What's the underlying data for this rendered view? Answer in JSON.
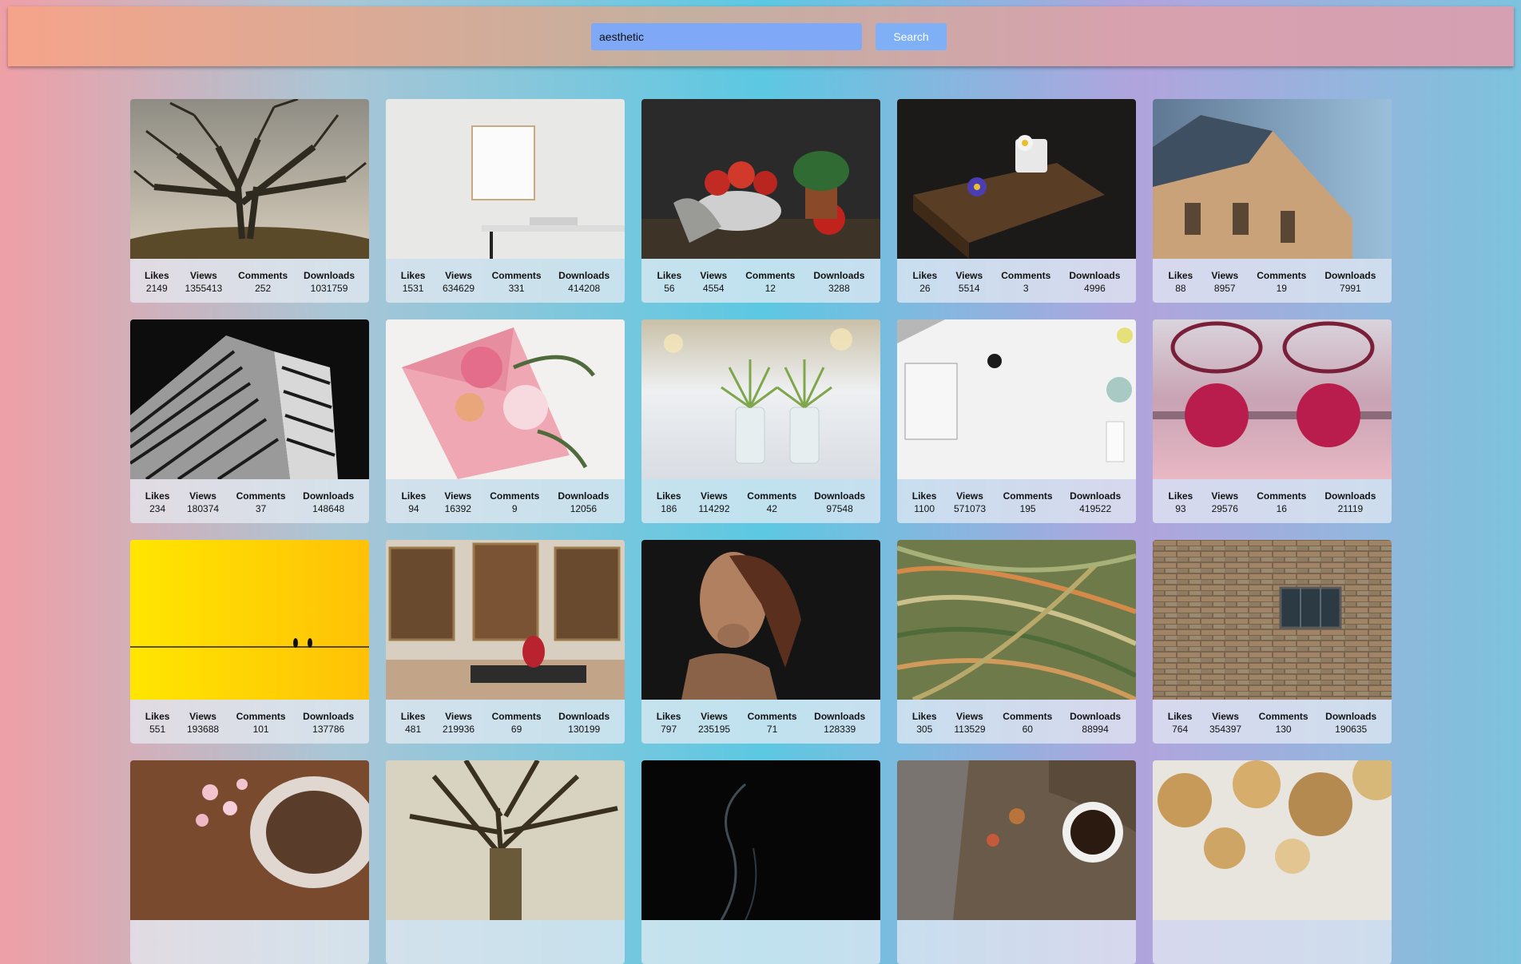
{
  "search": {
    "value": "aesthetic",
    "button_label": "Search"
  },
  "stat_labels": {
    "likes": "Likes",
    "views": "Views",
    "comments": "Comments",
    "downloads": "Downloads"
  },
  "cards": [
    {
      "likes": "2149",
      "views": "1355413",
      "comments": "252",
      "downloads": "1031759"
    },
    {
      "likes": "1531",
      "views": "634629",
      "comments": "331",
      "downloads": "414208"
    },
    {
      "likes": "56",
      "views": "4554",
      "comments": "12",
      "downloads": "3288"
    },
    {
      "likes": "26",
      "views": "5514",
      "comments": "3",
      "downloads": "4996"
    },
    {
      "likes": "88",
      "views": "8957",
      "comments": "19",
      "downloads": "7991"
    },
    {
      "likes": "234",
      "views": "180374",
      "comments": "37",
      "downloads": "148648"
    },
    {
      "likes": "94",
      "views": "16392",
      "comments": "9",
      "downloads": "12056"
    },
    {
      "likes": "186",
      "views": "114292",
      "comments": "42",
      "downloads": "97548"
    },
    {
      "likes": "1100",
      "views": "571073",
      "comments": "195",
      "downloads": "419522"
    },
    {
      "likes": "93",
      "views": "29576",
      "comments": "16",
      "downloads": "21119"
    },
    {
      "likes": "551",
      "views": "193688",
      "comments": "101",
      "downloads": "137786"
    },
    {
      "likes": "481",
      "views": "219936",
      "comments": "69",
      "downloads": "130199"
    },
    {
      "likes": "797",
      "views": "235195",
      "comments": "71",
      "downloads": "128339"
    },
    {
      "likes": "305",
      "views": "113529",
      "comments": "60",
      "downloads": "88994"
    },
    {
      "likes": "764",
      "views": "354397",
      "comments": "130",
      "downloads": "190635"
    }
  ]
}
